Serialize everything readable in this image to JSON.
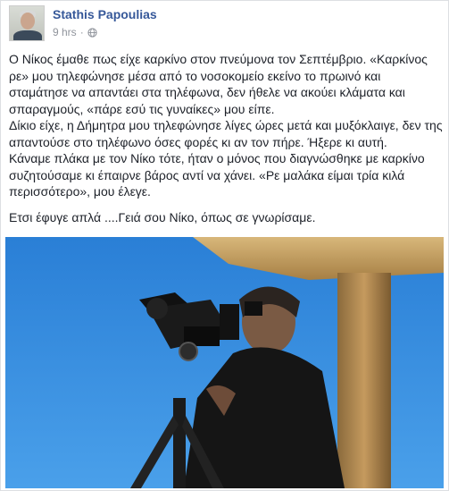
{
  "post": {
    "author": "Stathis Papoulias",
    "time": "9 hrs",
    "separator": "·",
    "privacy_icon": "globe-icon",
    "paragraphs": [
      "Ο Νίκος έμαθε πως είχε καρκίνο στον πνεύμονα τον Σεπτέμβριο. «Καρκίνος ρε» μου τηλεφώνησε μέσα από το νοσοκομείο εκείνο το πρωινό και σταμάτησε να απαντάει στα τηλέφωνα, δεν ήθελε να ακούει κλάματα και σπαραγμούς, «πάρε εσύ τις γυναίκες» μου είπε.",
      "Δίκιο είχε, η Δήμητρα μου τηλεφώνησε λίγες ώρες μετά και μυξόκλαιγε, δεν της απαντούσε στο τηλέφωνο όσες φορές κι αν τον πήρε. Ήξερε κι αυτή.",
      "Κάναμε πλάκα με τον Νίκο τότε, ήταν ο μόνος που διαγνώσθηκε με καρκίνο συζητούσαμε κι έπαιρνε βάρος αντί να χάνει. «Ρε μαλάκα είμαι τρία κιλά περισσότερο», μου έλεγε.",
      "Ετσι έφυγε απλά ....Γειά σου Νίκο, όπως σε γνωρίσαμε."
    ]
  }
}
